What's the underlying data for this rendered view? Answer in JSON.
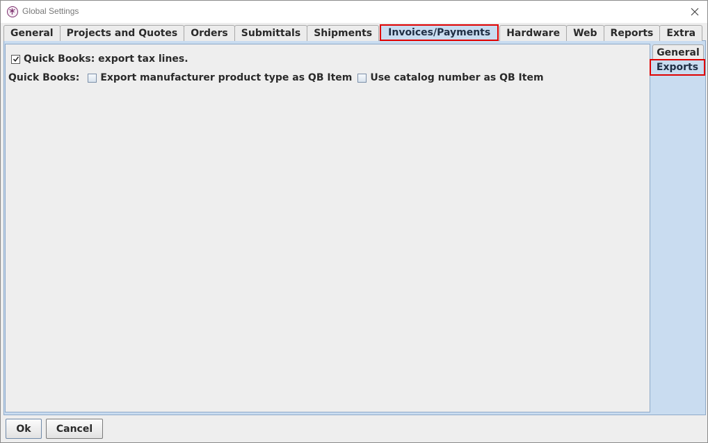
{
  "window": {
    "title": "Global Settings",
    "app_icon": "palm-tree-logo-icon",
    "close_icon": "close-icon"
  },
  "tabs": [
    {
      "label": "General",
      "selected": false
    },
    {
      "label": "Projects and Quotes",
      "selected": false
    },
    {
      "label": "Orders",
      "selected": false
    },
    {
      "label": "Submittals",
      "selected": false
    },
    {
      "label": "Shipments",
      "selected": false
    },
    {
      "label": "Invoices/Payments",
      "selected": true
    },
    {
      "label": "Hardware",
      "selected": false
    },
    {
      "label": "Web",
      "selected": false
    },
    {
      "label": "Reports",
      "selected": false
    },
    {
      "label": "Extra",
      "selected": false
    }
  ],
  "side_tabs": [
    {
      "label": "General",
      "selected": false
    },
    {
      "label": "Exports",
      "selected": true
    }
  ],
  "content": {
    "export_tax_lines": {
      "label": "Quick Books: export tax lines.",
      "checked": true
    },
    "quickbooks_label": "Quick Books:",
    "manufacturer_type": {
      "label": "Export manufacturer product type as QB Item",
      "checked": false
    },
    "catalog_number": {
      "label": "Use catalog number as QB Item",
      "checked": false
    }
  },
  "buttons": {
    "ok": "Ok",
    "cancel": "Cancel"
  },
  "colors": {
    "selected_tab": "#c9dcf0",
    "highlight": "#e00000",
    "panel_bg": "#eeeeee"
  }
}
